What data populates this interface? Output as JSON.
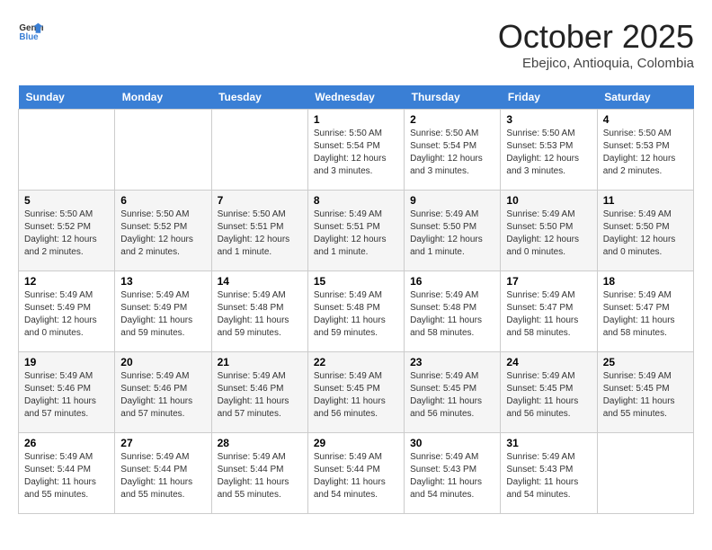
{
  "header": {
    "logo_line1": "General",
    "logo_line2": "Blue",
    "month": "October 2025",
    "location": "Ebejico, Antioquia, Colombia"
  },
  "days_of_week": [
    "Sunday",
    "Monday",
    "Tuesday",
    "Wednesday",
    "Thursday",
    "Friday",
    "Saturday"
  ],
  "weeks": [
    [
      {
        "day": "",
        "content": ""
      },
      {
        "day": "",
        "content": ""
      },
      {
        "day": "",
        "content": ""
      },
      {
        "day": "1",
        "content": "Sunrise: 5:50 AM\nSunset: 5:54 PM\nDaylight: 12 hours\nand 3 minutes."
      },
      {
        "day": "2",
        "content": "Sunrise: 5:50 AM\nSunset: 5:54 PM\nDaylight: 12 hours\nand 3 minutes."
      },
      {
        "day": "3",
        "content": "Sunrise: 5:50 AM\nSunset: 5:53 PM\nDaylight: 12 hours\nand 3 minutes."
      },
      {
        "day": "4",
        "content": "Sunrise: 5:50 AM\nSunset: 5:53 PM\nDaylight: 12 hours\nand 2 minutes."
      }
    ],
    [
      {
        "day": "5",
        "content": "Sunrise: 5:50 AM\nSunset: 5:52 PM\nDaylight: 12 hours\nand 2 minutes."
      },
      {
        "day": "6",
        "content": "Sunrise: 5:50 AM\nSunset: 5:52 PM\nDaylight: 12 hours\nand 2 minutes."
      },
      {
        "day": "7",
        "content": "Sunrise: 5:50 AM\nSunset: 5:51 PM\nDaylight: 12 hours\nand 1 minute."
      },
      {
        "day": "8",
        "content": "Sunrise: 5:49 AM\nSunset: 5:51 PM\nDaylight: 12 hours\nand 1 minute."
      },
      {
        "day": "9",
        "content": "Sunrise: 5:49 AM\nSunset: 5:50 PM\nDaylight: 12 hours\nand 1 minute."
      },
      {
        "day": "10",
        "content": "Sunrise: 5:49 AM\nSunset: 5:50 PM\nDaylight: 12 hours\nand 0 minutes."
      },
      {
        "day": "11",
        "content": "Sunrise: 5:49 AM\nSunset: 5:50 PM\nDaylight: 12 hours\nand 0 minutes."
      }
    ],
    [
      {
        "day": "12",
        "content": "Sunrise: 5:49 AM\nSunset: 5:49 PM\nDaylight: 12 hours\nand 0 minutes."
      },
      {
        "day": "13",
        "content": "Sunrise: 5:49 AM\nSunset: 5:49 PM\nDaylight: 11 hours\nand 59 minutes."
      },
      {
        "day": "14",
        "content": "Sunrise: 5:49 AM\nSunset: 5:48 PM\nDaylight: 11 hours\nand 59 minutes."
      },
      {
        "day": "15",
        "content": "Sunrise: 5:49 AM\nSunset: 5:48 PM\nDaylight: 11 hours\nand 59 minutes."
      },
      {
        "day": "16",
        "content": "Sunrise: 5:49 AM\nSunset: 5:48 PM\nDaylight: 11 hours\nand 58 minutes."
      },
      {
        "day": "17",
        "content": "Sunrise: 5:49 AM\nSunset: 5:47 PM\nDaylight: 11 hours\nand 58 minutes."
      },
      {
        "day": "18",
        "content": "Sunrise: 5:49 AM\nSunset: 5:47 PM\nDaylight: 11 hours\nand 58 minutes."
      }
    ],
    [
      {
        "day": "19",
        "content": "Sunrise: 5:49 AM\nSunset: 5:46 PM\nDaylight: 11 hours\nand 57 minutes."
      },
      {
        "day": "20",
        "content": "Sunrise: 5:49 AM\nSunset: 5:46 PM\nDaylight: 11 hours\nand 57 minutes."
      },
      {
        "day": "21",
        "content": "Sunrise: 5:49 AM\nSunset: 5:46 PM\nDaylight: 11 hours\nand 57 minutes."
      },
      {
        "day": "22",
        "content": "Sunrise: 5:49 AM\nSunset: 5:45 PM\nDaylight: 11 hours\nand 56 minutes."
      },
      {
        "day": "23",
        "content": "Sunrise: 5:49 AM\nSunset: 5:45 PM\nDaylight: 11 hours\nand 56 minutes."
      },
      {
        "day": "24",
        "content": "Sunrise: 5:49 AM\nSunset: 5:45 PM\nDaylight: 11 hours\nand 56 minutes."
      },
      {
        "day": "25",
        "content": "Sunrise: 5:49 AM\nSunset: 5:45 PM\nDaylight: 11 hours\nand 55 minutes."
      }
    ],
    [
      {
        "day": "26",
        "content": "Sunrise: 5:49 AM\nSunset: 5:44 PM\nDaylight: 11 hours\nand 55 minutes."
      },
      {
        "day": "27",
        "content": "Sunrise: 5:49 AM\nSunset: 5:44 PM\nDaylight: 11 hours\nand 55 minutes."
      },
      {
        "day": "28",
        "content": "Sunrise: 5:49 AM\nSunset: 5:44 PM\nDaylight: 11 hours\nand 55 minutes."
      },
      {
        "day": "29",
        "content": "Sunrise: 5:49 AM\nSunset: 5:44 PM\nDaylight: 11 hours\nand 54 minutes."
      },
      {
        "day": "30",
        "content": "Sunrise: 5:49 AM\nSunset: 5:43 PM\nDaylight: 11 hours\nand 54 minutes."
      },
      {
        "day": "31",
        "content": "Sunrise: 5:49 AM\nSunset: 5:43 PM\nDaylight: 11 hours\nand 54 minutes."
      },
      {
        "day": "",
        "content": ""
      }
    ]
  ]
}
